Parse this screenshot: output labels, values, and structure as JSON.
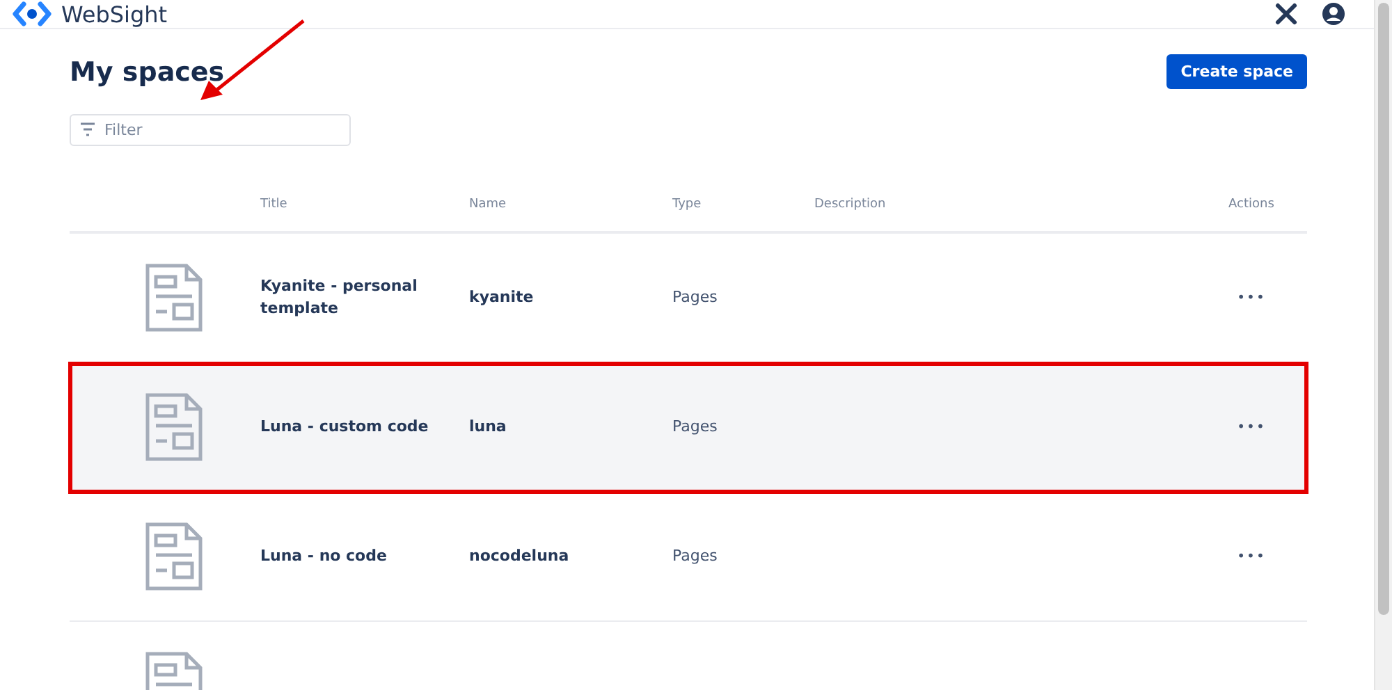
{
  "header": {
    "brand": "WebSight"
  },
  "page": {
    "title": "My spaces",
    "title_arrow": true,
    "create_button": "Create space"
  },
  "filter": {
    "placeholder": "Filter"
  },
  "table": {
    "columns": [
      "Title",
      "Name",
      "Type",
      "Description",
      "Actions"
    ],
    "rows": [
      {
        "kind": "full",
        "title": "Kyanite - personal template",
        "name": "kyanite",
        "type": "Pages",
        "actions": "•••",
        "highlighted": false
      },
      {
        "kind": "full",
        "title": "Luna - custom code",
        "name": "luna",
        "type": "Pages",
        "actions": "•••",
        "highlighted": true
      },
      {
        "kind": "full",
        "title": "Luna - no code",
        "name": "nocodeluna",
        "type": "Pages",
        "actions": "•••",
        "highlighted": false
      },
      {
        "kind": "partial",
        "highlighted": false
      }
    ]
  }
}
